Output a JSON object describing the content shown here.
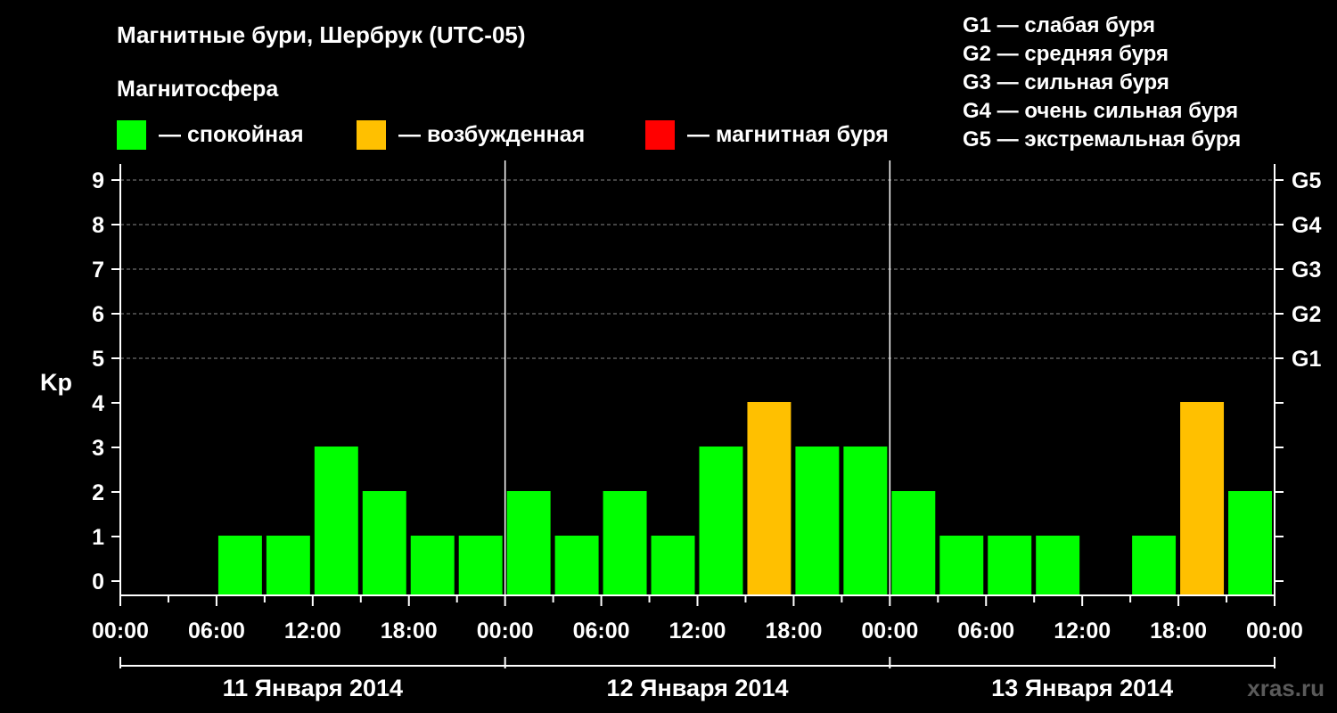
{
  "header": {
    "title": "Магнитные бури, Шербрук (UTC-05)",
    "subtitle": "Магнитосфера"
  },
  "legend": [
    {
      "label": "— спокойная",
      "color": "#00ff00"
    },
    {
      "label": "— возбужденная",
      "color": "#ffc000"
    },
    {
      "label": "— магнитная буря",
      "color": "#ff0000"
    }
  ],
  "g_levels": [
    "G1 — слабая буря",
    "G2 — средняя буря",
    "G3 — сильная буря",
    "G4 — очень сильная буря",
    "G5 — экстремальная буря"
  ],
  "watermark": "xras.ru",
  "chart_data": {
    "type": "bar",
    "ylabel": "Kp",
    "ylim": [
      0,
      9
    ],
    "yticks": [
      "0",
      "1",
      "2",
      "3",
      "4",
      "5",
      "6",
      "7",
      "8",
      "9"
    ],
    "right_ticks": [
      {
        "kp": 5,
        "label": "G1"
      },
      {
        "kp": 6,
        "label": "G2"
      },
      {
        "kp": 7,
        "label": "G3"
      },
      {
        "kp": 8,
        "label": "G4"
      },
      {
        "kp": 9,
        "label": "G5"
      }
    ],
    "grid": "dashed horizontal at Kp 5–9",
    "xtick_labels": [
      "00:00",
      "06:00",
      "12:00",
      "18:00",
      "00:00",
      "06:00",
      "12:00",
      "18:00",
      "00:00",
      "06:00",
      "12:00",
      "18:00",
      "00:00"
    ],
    "days": [
      "11 Января 2014",
      "12 Января 2014",
      "13 Января 2014"
    ],
    "interval_hours": 3,
    "values": [
      0,
      0,
      1,
      1,
      3,
      2,
      1,
      1,
      2,
      1,
      2,
      1,
      3,
      4,
      3,
      3,
      2,
      1,
      1,
      1,
      0,
      1,
      4,
      2
    ],
    "colors": {
      "quiet": "#00ff00",
      "unsettled": "#ffc000",
      "storm": "#ff0000"
    }
  }
}
